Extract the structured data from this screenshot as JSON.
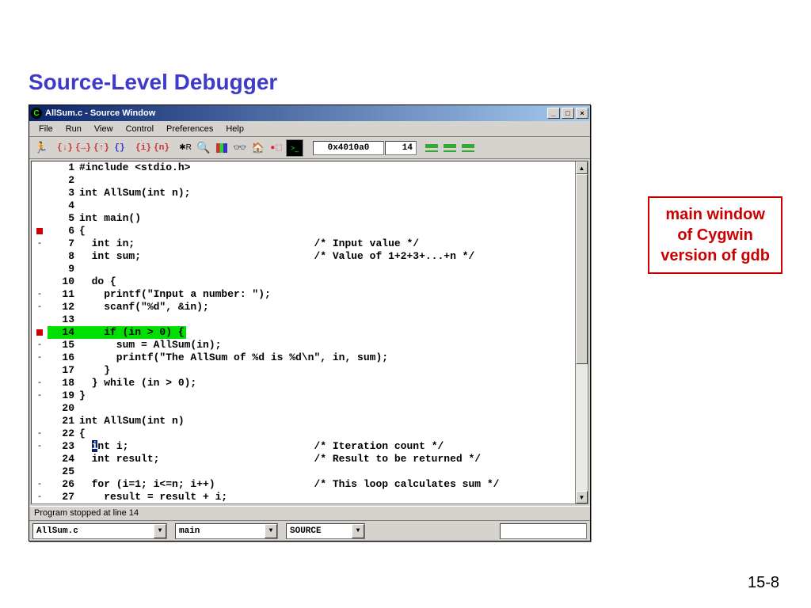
{
  "slide": {
    "title": "Source-Level Debugger",
    "callout": "main window\nof Cygwin\nversion of gdb",
    "page_number": "15-8"
  },
  "window": {
    "title": "AllSum.c - Source Window",
    "menus": [
      "File",
      "Run",
      "View",
      "Control",
      "Preferences",
      "Help"
    ],
    "address": "0x4010a0",
    "current_line": "14",
    "status": "Program stopped at line 14",
    "file_combo": "AllSum.c",
    "func_combo": "main",
    "mode_combo": "SOURCE"
  },
  "code": [
    {
      "n": 1,
      "g": "",
      "t": "#include <stdio.h>"
    },
    {
      "n": 2,
      "g": "",
      "t": ""
    },
    {
      "n": 3,
      "g": "",
      "t": "int AllSum(int n);"
    },
    {
      "n": 4,
      "g": "",
      "t": ""
    },
    {
      "n": 5,
      "g": "",
      "t": "int main()"
    },
    {
      "n": 6,
      "g": "bp",
      "t": "{"
    },
    {
      "n": 7,
      "g": "-",
      "t": "  int in;                             /* Input value */"
    },
    {
      "n": 8,
      "g": "",
      "t": "  int sum;                            /* Value of 1+2+3+...+n */"
    },
    {
      "n": 9,
      "g": "",
      "t": ""
    },
    {
      "n": 10,
      "g": "",
      "t": "  do {"
    },
    {
      "n": 11,
      "g": "-",
      "t": "    printf(\"Input a number: \");"
    },
    {
      "n": 12,
      "g": "-",
      "t": "    scanf(\"%d\", &in);"
    },
    {
      "n": 13,
      "g": "",
      "t": ""
    },
    {
      "n": 14,
      "g": "bp",
      "t": "    if (in > 0) {",
      "hl": true
    },
    {
      "n": 15,
      "g": "-",
      "t": "      sum = AllSum(in);"
    },
    {
      "n": 16,
      "g": "-",
      "t": "      printf(\"The AllSum of %d is %d\\n\", in, sum);"
    },
    {
      "n": 17,
      "g": "",
      "t": "    }"
    },
    {
      "n": 18,
      "g": "-",
      "t": "  } while (in > 0);"
    },
    {
      "n": 19,
      "g": "-",
      "t": "}"
    },
    {
      "n": 20,
      "g": "",
      "t": ""
    },
    {
      "n": 21,
      "g": "",
      "t": "int AllSum(int n)"
    },
    {
      "n": 22,
      "g": "-",
      "t": "{"
    },
    {
      "n": 23,
      "g": "-",
      "t": "  int i;                              /* Iteration count */",
      "var_hl": "i"
    },
    {
      "n": 24,
      "g": "",
      "t": "  int result;                         /* Result to be returned */"
    },
    {
      "n": 25,
      "g": "",
      "t": ""
    },
    {
      "n": 26,
      "g": "-",
      "t": "  for (i=1; i<=n; i++)                /* This loop calculates sum */"
    },
    {
      "n": 27,
      "g": "-",
      "t": "    result = result + i;"
    }
  ]
}
